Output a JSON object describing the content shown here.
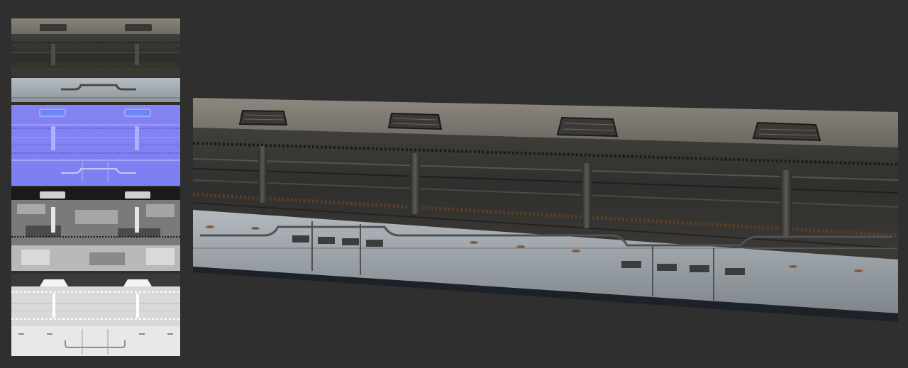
{
  "scene": {
    "background_color": "#2f2f2f",
    "texture_maps": [
      {
        "name": "diffuse-map",
        "kind": "diffuse",
        "tint": "#6e6e68"
      },
      {
        "name": "normal-map",
        "kind": "normal",
        "tint": "#7a7ff2"
      },
      {
        "name": "specular-map",
        "kind": "specular",
        "tint": "#9c9c9c"
      },
      {
        "name": "ambient-occlusion-map",
        "kind": "ambient-occlusion",
        "tint": "#d8d8d8"
      }
    ],
    "preview": {
      "name": "wall-mesh-preview",
      "vent_count": 4,
      "pillar_count": 4
    }
  }
}
